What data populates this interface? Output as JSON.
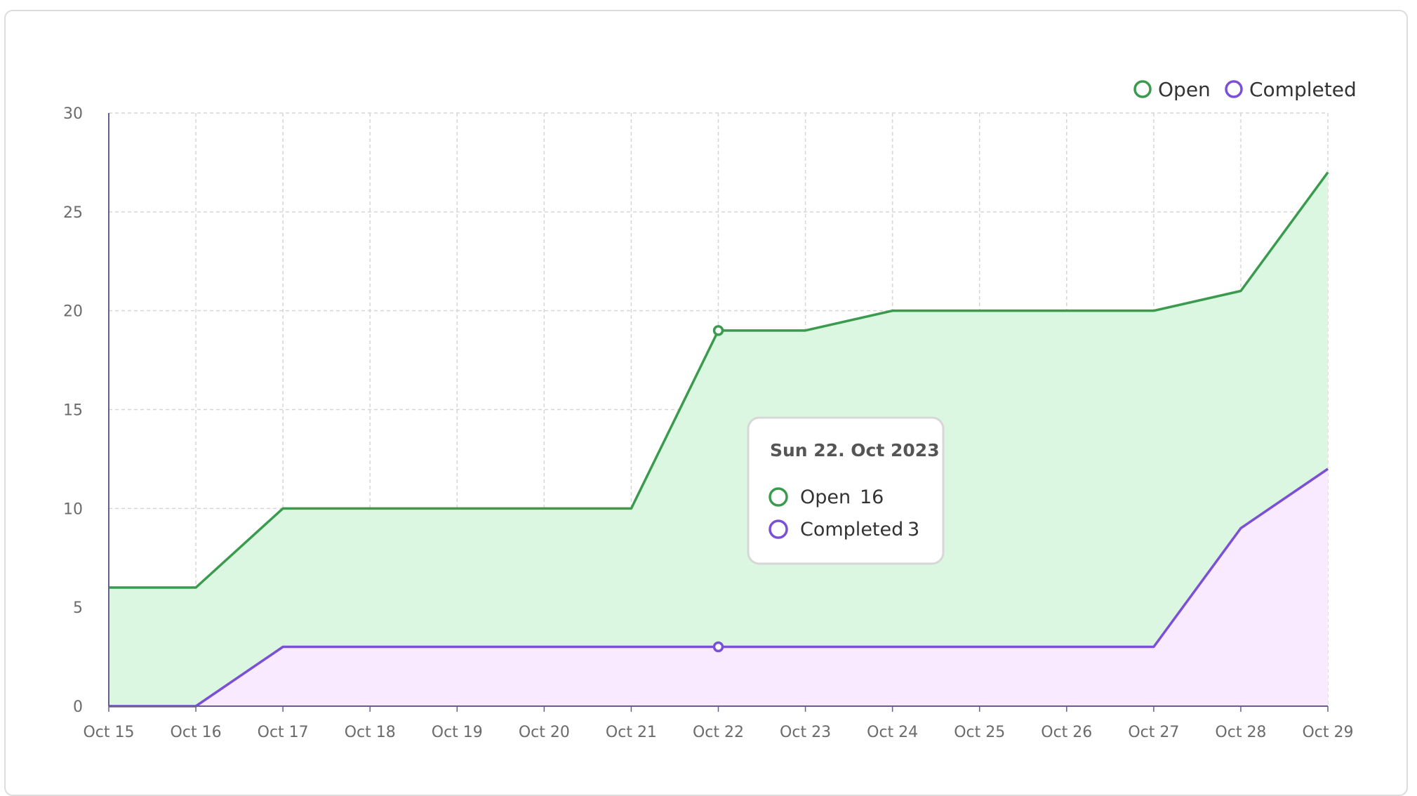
{
  "chart_data": {
    "type": "area",
    "x": [
      "Oct 15",
      "Oct 16",
      "Oct 17",
      "Oct 18",
      "Oct 19",
      "Oct 20",
      "Oct 21",
      "Oct 22",
      "Oct 23",
      "Oct 24",
      "Oct 25",
      "Oct 26",
      "Oct 27",
      "Oct 28",
      "Oct 29"
    ],
    "stacked": true,
    "series": [
      {
        "name": "Completed",
        "values": [
          0,
          0,
          3,
          3,
          3,
          3,
          3,
          3,
          3,
          3,
          3,
          3,
          3,
          9,
          12
        ],
        "color": "#7b4fd6",
        "fill": "#f9eaff"
      },
      {
        "name": "Open",
        "values": [
          6,
          6,
          7,
          7,
          7,
          7,
          7,
          16,
          16,
          17,
          17,
          17,
          17,
          12,
          15
        ],
        "color": "#3a9b4e",
        "fill": "#dbf7e1"
      }
    ],
    "ylim": [
      0,
      30
    ],
    "yticks": [
      0,
      5,
      10,
      15,
      20,
      25,
      30
    ],
    "grid": true,
    "legend": "top-right",
    "legend_items": [
      "Open",
      "Completed"
    ],
    "tooltip": {
      "title": "Sun 22. Oct 2023",
      "rows": [
        {
          "label": "Open",
          "value": "16"
        },
        {
          "label": "Completed",
          "value": "3"
        }
      ],
      "index": 7
    }
  }
}
